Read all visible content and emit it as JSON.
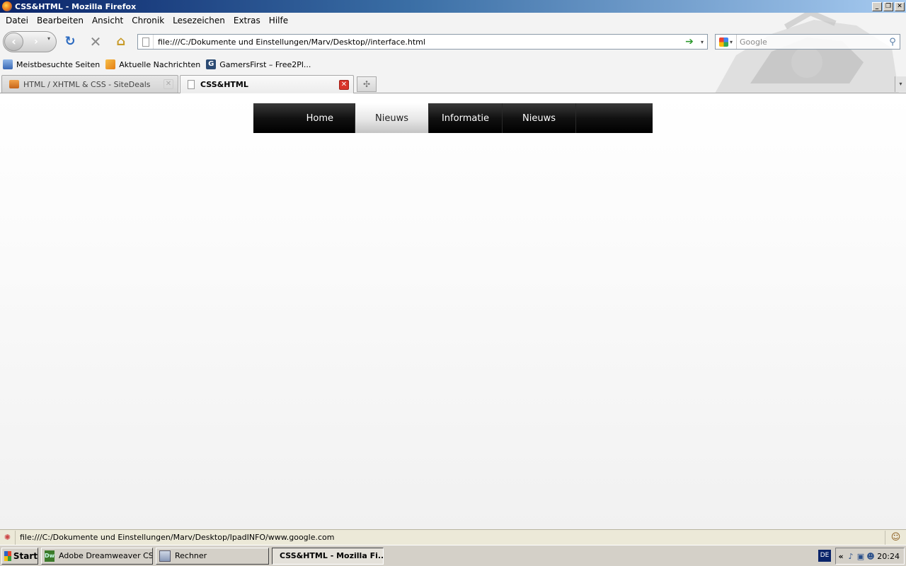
{
  "window": {
    "title": "CSS&HTML - Mozilla Firefox",
    "controls": [
      "_",
      "❐",
      "✕"
    ]
  },
  "menubar": {
    "items": [
      "Datei",
      "Bearbeiten",
      "Ansicht",
      "Chronik",
      "Lesezeichen",
      "Extras",
      "Hilfe"
    ]
  },
  "navbar": {
    "back_glyph": "‹",
    "forward_glyph": "›",
    "history_dropdown": "▾",
    "reload_glyph": "↻",
    "stop_glyph": "✕",
    "home_glyph": "⌂",
    "url": "file:///C:/Dokumente und Einstellungen/Marv/Desktop//interface.html",
    "go_glyph": "➔",
    "url_dropdown": "▾",
    "search_placeholder": "Google",
    "search_engine_dropdown": "▾",
    "magnifier_glyph": "⚲"
  },
  "bookmarks": [
    {
      "label": "Meistbesuchte Seiten",
      "icon": "folder-icon"
    },
    {
      "label": "Aktuelle Nachrichten",
      "icon": "rss-icon"
    },
    {
      "label": "GamersFirst – Free2Pl...",
      "icon": "gamersfirst-icon",
      "glyph": "G"
    }
  ],
  "tabs": [
    {
      "label": "HTML / XHTML & CSS - SiteDeals",
      "active": false,
      "close": "✕"
    },
    {
      "label": "CSS&HTML",
      "active": true,
      "close": "✕"
    }
  ],
  "new_tab_glyph": "✣",
  "tablist_glyph": "▾",
  "page": {
    "nav": [
      {
        "label": "Home",
        "active": false
      },
      {
        "label": "Nieuws",
        "active": true
      },
      {
        "label": "Informatie",
        "active": false
      },
      {
        "label": "Nieuws",
        "active": false
      }
    ]
  },
  "statusbar": {
    "text": "file:///C:/Dokumente und Einstellungen/Marv/Desktop/IpadINFO/www.google.com",
    "left_glyph": "✺",
    "right_glyph": "☺"
  },
  "taskbar": {
    "start_label": "Start",
    "tasks": [
      {
        "label": "Adobe Dreamweaver CS...",
        "icon_text": "Dw",
        "active": false
      },
      {
        "label": "Rechner",
        "icon_text": "",
        "active": false
      },
      {
        "label": "CSS&HTML - Mozilla Fi...",
        "icon_text": "",
        "active": true
      }
    ],
    "language": "DE",
    "tray_chevron": "«",
    "clock": "20:24"
  },
  "colors": {
    "titlebar_start": "#0a246a",
    "site_nav_bg": "#111111",
    "site_nav_active": "#e6e6e6",
    "close_red": "#d8342a"
  }
}
